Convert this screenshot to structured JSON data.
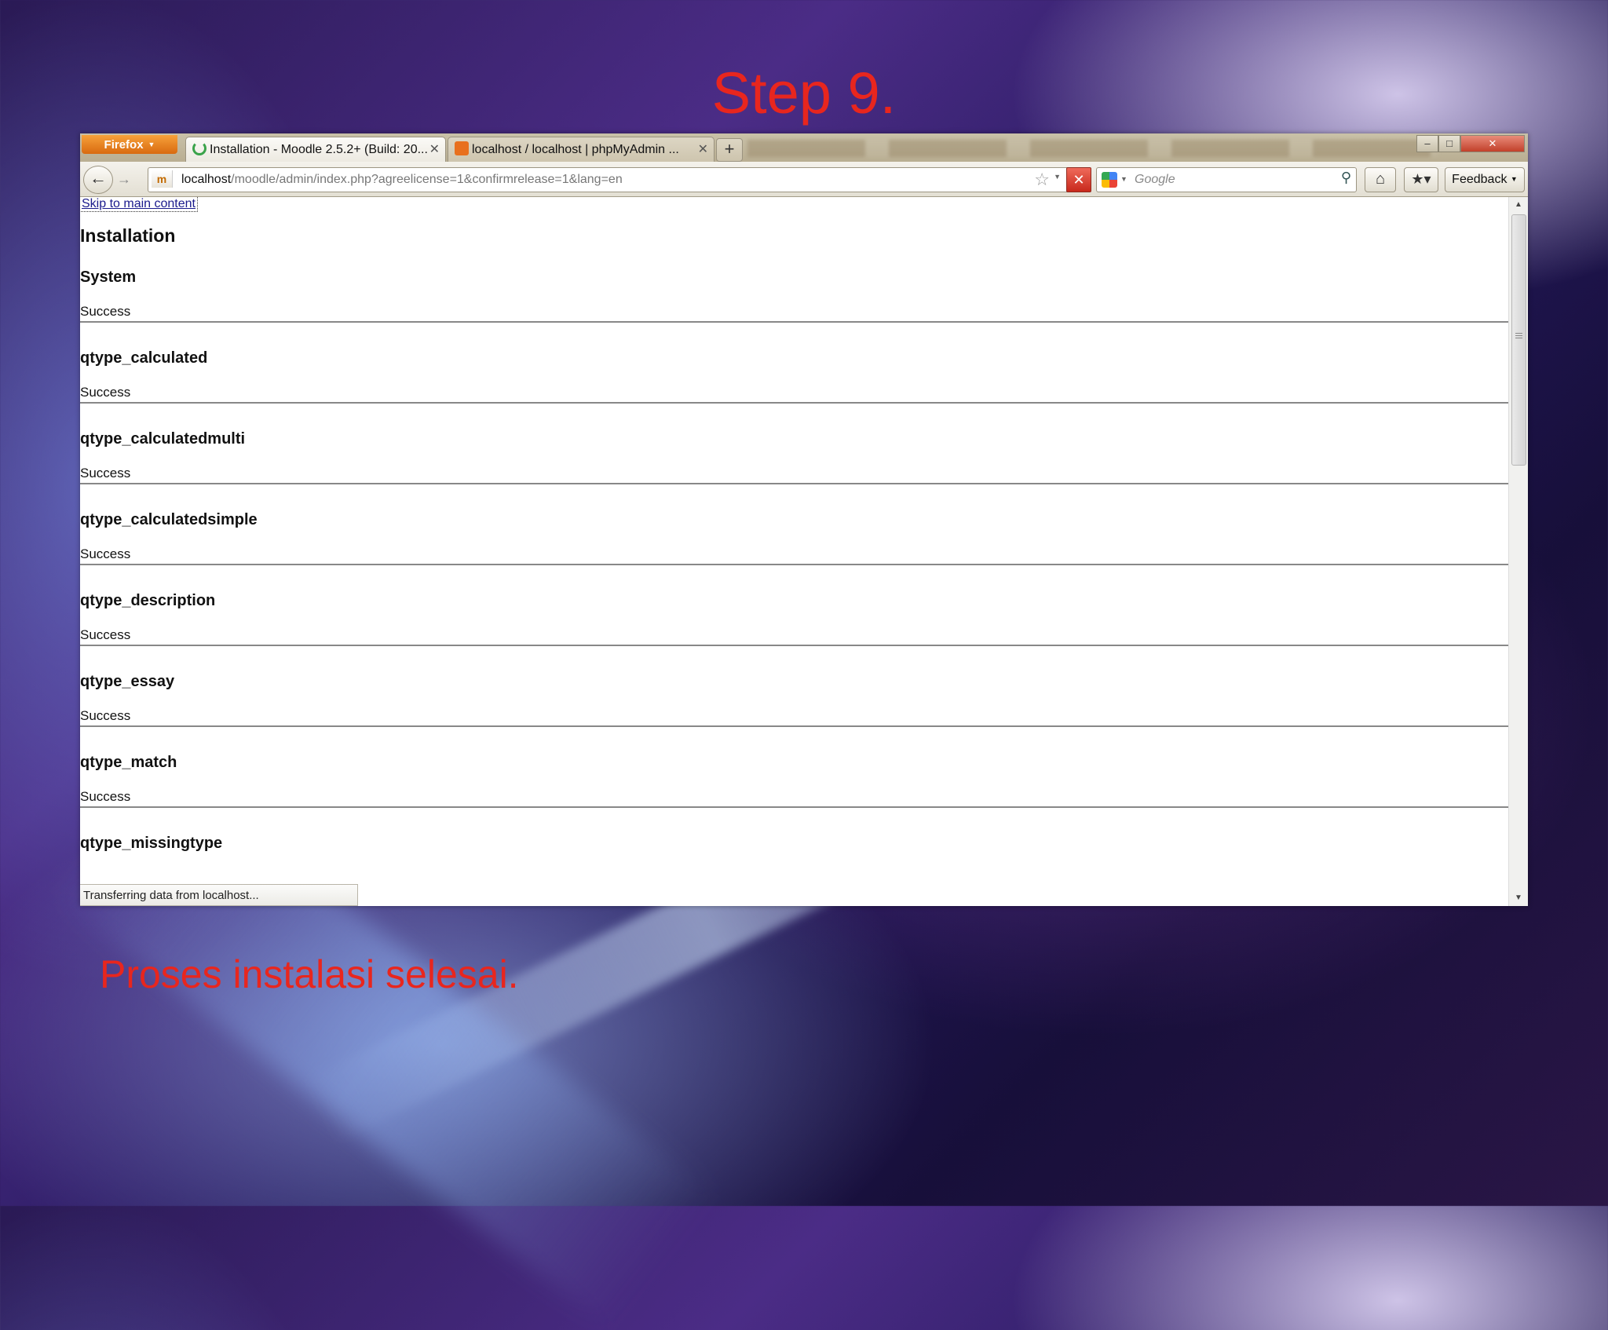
{
  "slide": {
    "title": "Step 9.",
    "caption": "Proses instalasi selesai."
  },
  "browser": {
    "menu_button": "Firefox",
    "tabs": [
      {
        "label": "Installation - Moodle 2.5.2+ (Build: 20...",
        "active": true
      },
      {
        "label": "localhost / localhost | phpMyAdmin ...",
        "active": false
      }
    ],
    "window_controls": {
      "minimize": "–",
      "maximize": "□",
      "close": "✕"
    },
    "url_host": "localhost",
    "url_path": "/moodle/admin/index.php?agreelicense=1&confirmrelease=1&lang=en",
    "search_placeholder": "Google",
    "feedback_label": "Feedback",
    "status_text": "Transferring data from localhost...",
    "colors": {
      "firefox_button": "#e07a1c",
      "stop_button": "#c8281c",
      "slide_text": "#e8261e"
    }
  },
  "page": {
    "skip_link": "Skip to main content",
    "heading": "Installation",
    "sections": [
      {
        "name": "System",
        "status": "Success"
      },
      {
        "name": "qtype_calculated",
        "status": "Success"
      },
      {
        "name": "qtype_calculatedmulti",
        "status": "Success"
      },
      {
        "name": "qtype_calculatedsimple",
        "status": "Success"
      },
      {
        "name": "qtype_description",
        "status": "Success"
      },
      {
        "name": "qtype_essay",
        "status": "Success"
      },
      {
        "name": "qtype_match",
        "status": "Success"
      },
      {
        "name": "qtype_missingtype",
        "status": ""
      }
    ]
  },
  "icons": [
    "back-arrow-icon",
    "forward-arrow-icon",
    "site-identity-icon",
    "bookmark-star-icon",
    "stop-icon",
    "google-icon",
    "search-icon",
    "home-icon",
    "bookmarks-icon",
    "loading-spinner-icon",
    "phpmyadmin-icon",
    "tab-close-icon",
    "new-tab-icon"
  ]
}
